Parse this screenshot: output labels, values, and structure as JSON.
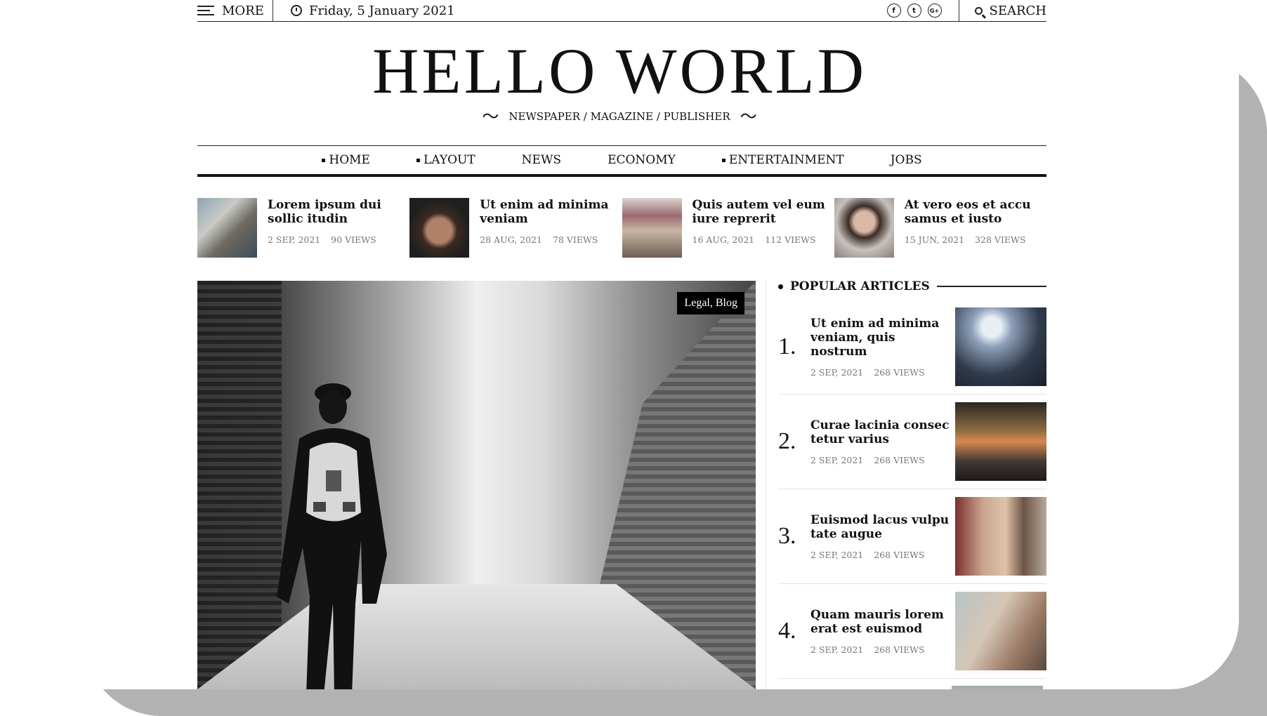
{
  "topbar": {
    "more_label": "MORE",
    "date": "Friday, 5 January 2021",
    "social": [
      "f",
      "t",
      "G+"
    ],
    "search_label": "SEARCH"
  },
  "masthead": {
    "logo": "HELLO WORLD",
    "tagline": "NEWSPAPER / MAGAZINE / PUBLISHER"
  },
  "nav": [
    {
      "label": "HOME",
      "bullet": true
    },
    {
      "label": "LAYOUT",
      "bullet": true
    },
    {
      "label": "NEWS",
      "bullet": false
    },
    {
      "label": "ECONOMY",
      "bullet": false
    },
    {
      "label": "ENTERTAINMENT",
      "bullet": true
    },
    {
      "label": "JOBS",
      "bullet": false
    }
  ],
  "ticker": [
    {
      "title": "Lorem ipsum dui sollic itudin",
      "date": "2 SEP, 2021",
      "views": "90 VIEWS",
      "img": "city-street"
    },
    {
      "title": "Ut enim ad minima veniam",
      "date": "28 AUG, 2021",
      "views": "78 VIEWS",
      "img": "bearded-man"
    },
    {
      "title": "Quis autem vel eum iure reprerit",
      "date": "16 AUG, 2021",
      "views": "112 VIEWS",
      "img": "laundry-alley"
    },
    {
      "title": "At vero eos et accu samus et iusto",
      "date": "15 JUN, 2021",
      "views": "328 VIEWS",
      "img": "woman-glasses"
    }
  ],
  "hero": {
    "badge": "Legal, Blog",
    "image": "person-walking-alley"
  },
  "sidebar": {
    "heading": "POPULAR ARTICLES",
    "items": [
      {
        "num": "1.",
        "title": "Ut enim ad minima veniam, quis nostrum",
        "date": "2 SEP, 2021",
        "views": "268 VIEWS",
        "img": "concert-crowd"
      },
      {
        "num": "2.",
        "title": "Curae lacinia consec tetur varius",
        "date": "2 SEP, 2021",
        "views": "268 VIEWS",
        "img": "night-motorcycles"
      },
      {
        "num": "3.",
        "title": "Euismod lacus vulpu tate augue",
        "date": "2 SEP, 2021",
        "views": "268 VIEWS",
        "img": "two-women"
      },
      {
        "num": "4.",
        "title": "Quam mauris lorem erat est euismod",
        "date": "2 SEP, 2021",
        "views": "268 VIEWS",
        "img": "man-profile"
      }
    ]
  },
  "colors": {
    "accent": "#111111",
    "meta": "#777777",
    "frame": "#b2b2b2"
  }
}
